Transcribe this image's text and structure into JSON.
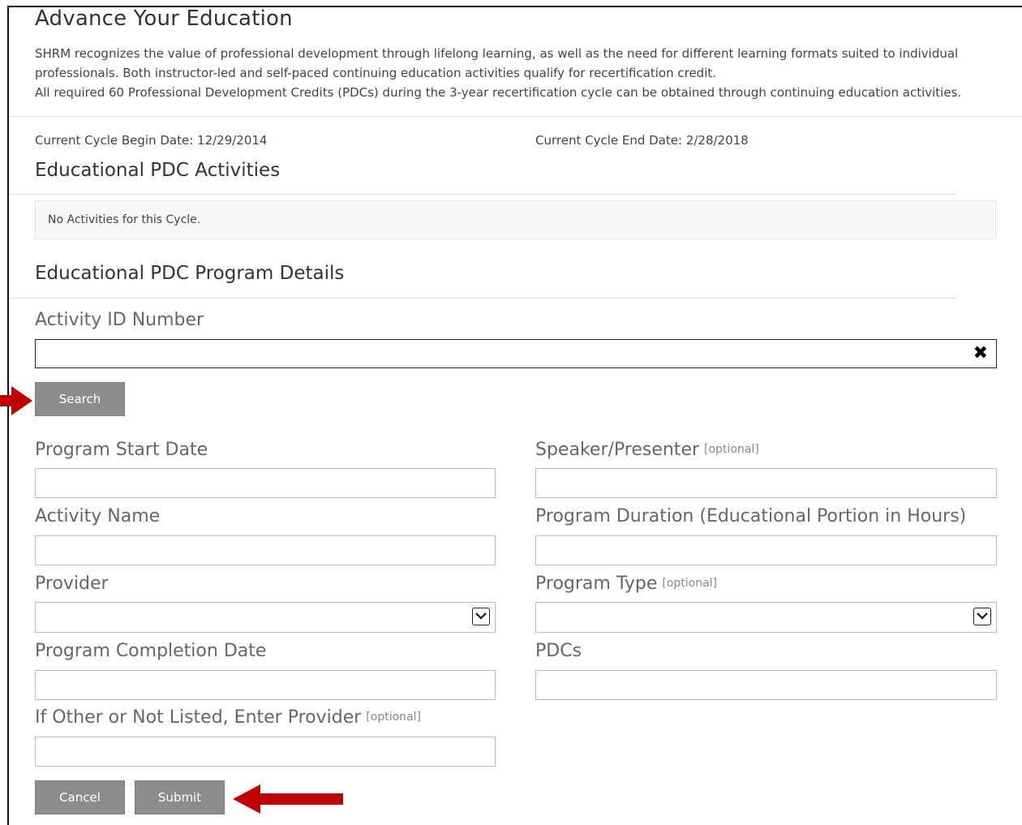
{
  "page": {
    "title": "Advance Your Education",
    "intro_lines": [
      "SHRM recognizes the value of professional development through lifelong learning, as well as the need for different learning formats suited to individual professionals. Both instructor-led and self-paced continuing education activities qualify for recertification credit.",
      "All required 60 Professional Development Credits (PDCs) during the 3-year recertification cycle can be obtained through continuing education activities."
    ]
  },
  "cycle": {
    "begin": "Current Cycle Begin Date: 12/29/2014",
    "end": "Current Cycle End Date: 2/28/2018"
  },
  "activities": {
    "heading": "Educational PDC Activities",
    "empty_text": "No Activities for this Cycle."
  },
  "program": {
    "heading": "Educational PDC Program Details",
    "activity_id_label": "Activity ID Number",
    "activity_id_value": "",
    "clear_glyph": "✖",
    "search_label": "Search",
    "fields": {
      "start_date": "Program Start Date",
      "speaker": "Speaker/Presenter",
      "activity_name": "Activity Name",
      "duration": "Program Duration (Educational Portion in Hours)",
      "provider": "Provider",
      "program_type": "Program Type",
      "completion_date": "Program Completion Date",
      "pdcs": "PDCs",
      "other_provider": "If Other or Not Listed, Enter Provider"
    },
    "optional_tag": "[optional]",
    "cancel_label": "Cancel",
    "submit_label": "Submit"
  },
  "colors": {
    "annotation_arrow": "#c00000",
    "button_bg": "#8c8c8c"
  }
}
